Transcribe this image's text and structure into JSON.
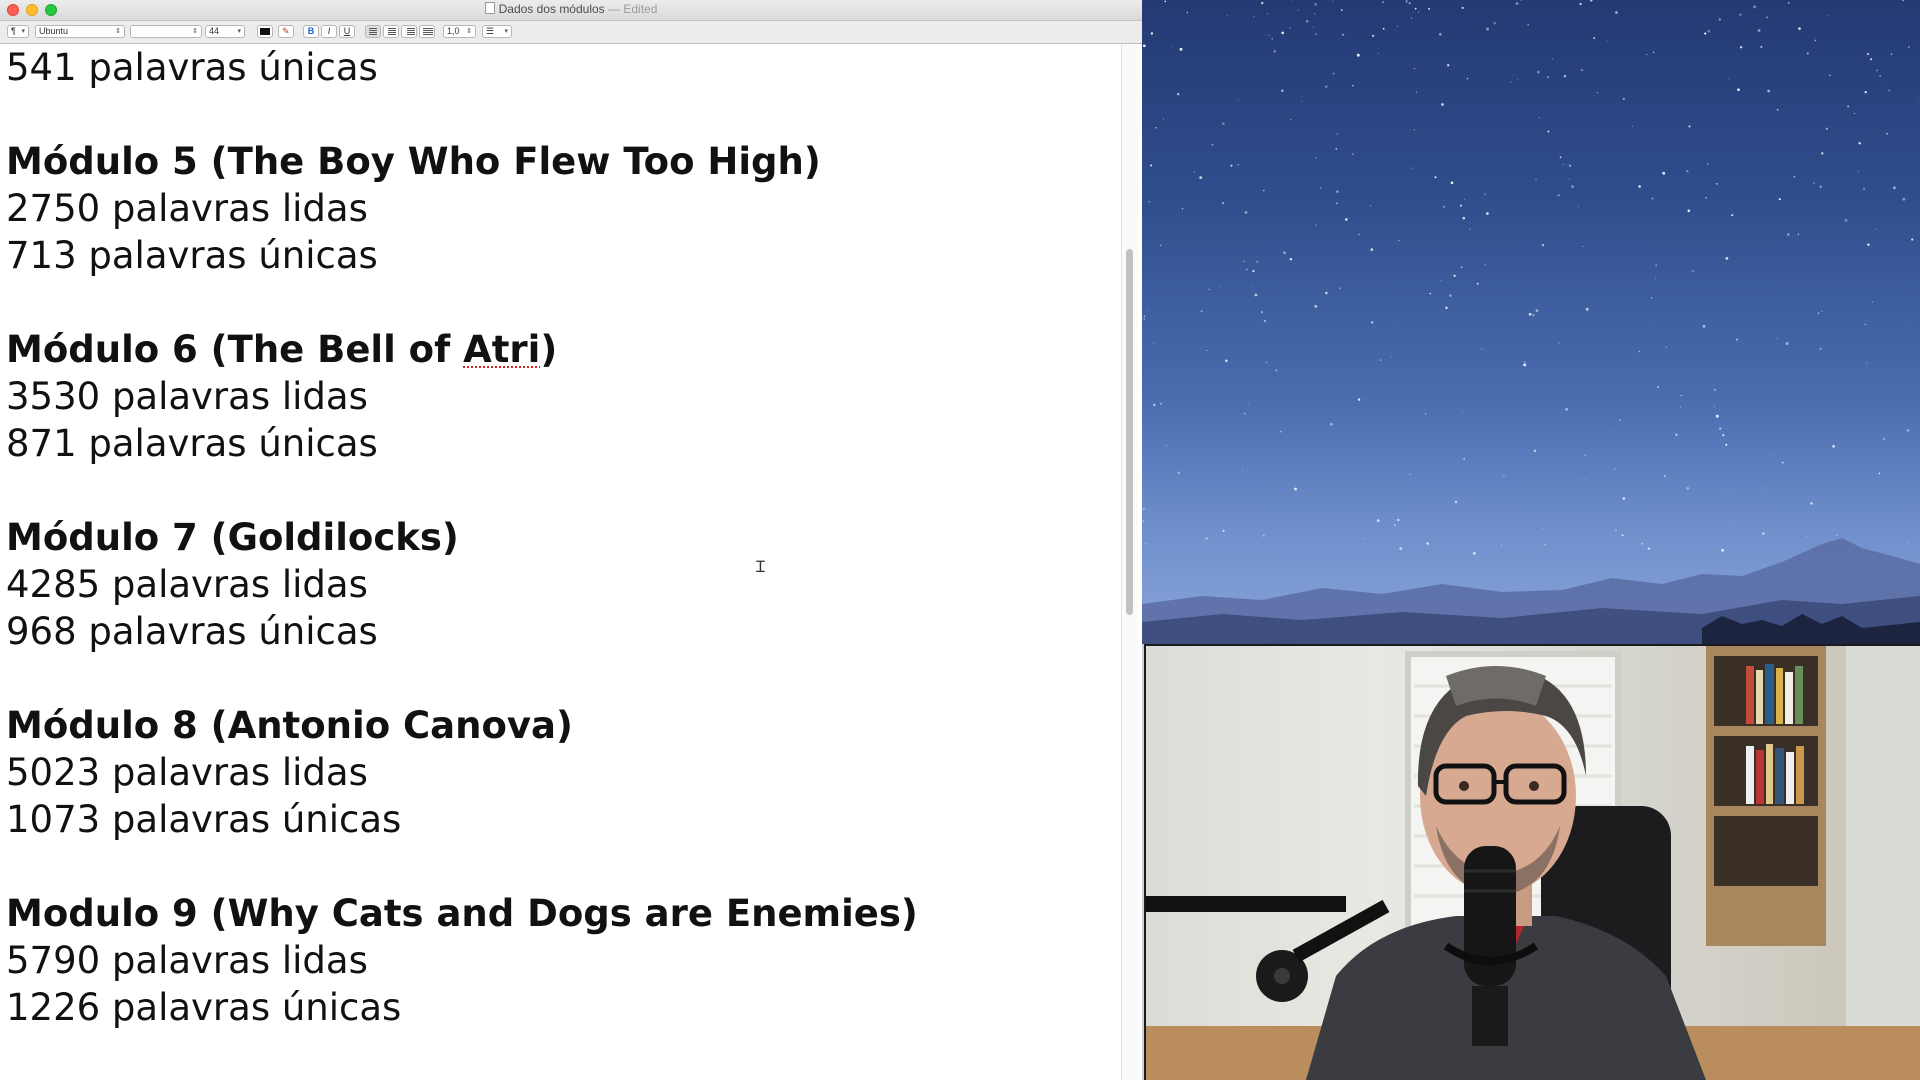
{
  "window": {
    "title": "Dados dos módulos",
    "edited_label": "— Edited"
  },
  "toolbar": {
    "paragraph_style": "¶",
    "font_family": "Ubuntu",
    "font_style": "",
    "font_size": "44",
    "bold_label": "B",
    "italic_label": "I",
    "underline_label": "U",
    "line_spacing": "1,0",
    "list_label": "☰"
  },
  "document": {
    "lines": [
      {
        "text": "541 palavras únicas",
        "heading": false
      },
      {
        "text": "",
        "heading": false
      },
      {
        "text": "Módulo 5 (The Boy Who Flew Too High)",
        "heading": true
      },
      {
        "text": "2750 palavras lidas",
        "heading": false
      },
      {
        "text": "713 palavras únicas",
        "heading": false
      },
      {
        "text": "",
        "heading": false
      },
      {
        "text": "Módulo 6 (The Bell of ",
        "heading": true,
        "spell_word": "Atri",
        "suffix": ")"
      },
      {
        "text": "3530 palavras lidas",
        "heading": false
      },
      {
        "text": "871 palavras únicas",
        "heading": false
      },
      {
        "text": "",
        "heading": false
      },
      {
        "text": "Módulo 7 (Goldilocks)",
        "heading": true
      },
      {
        "text": "4285 palavras lidas",
        "heading": false
      },
      {
        "text": "968 palavras únicas",
        "heading": false
      },
      {
        "text": "",
        "heading": false
      },
      {
        "text": "Módulo 8 (Antonio Canova)",
        "heading": true
      },
      {
        "text": "5023 palavras lidas",
        "heading": false
      },
      {
        "text": "1073 palavras únicas",
        "heading": false
      },
      {
        "text": "",
        "heading": false
      },
      {
        "text": "Modulo 9 (Why Cats and Dogs are Enemies)",
        "heading": true
      },
      {
        "text": "5790 palavras lidas",
        "heading": false
      },
      {
        "text": "1226 palavras únicas",
        "heading": false
      }
    ]
  },
  "colors": {
    "close": "#fd5f57",
    "minimize": "#febc2e",
    "maximize": "#28c840",
    "spellcheck": "#e02020"
  }
}
